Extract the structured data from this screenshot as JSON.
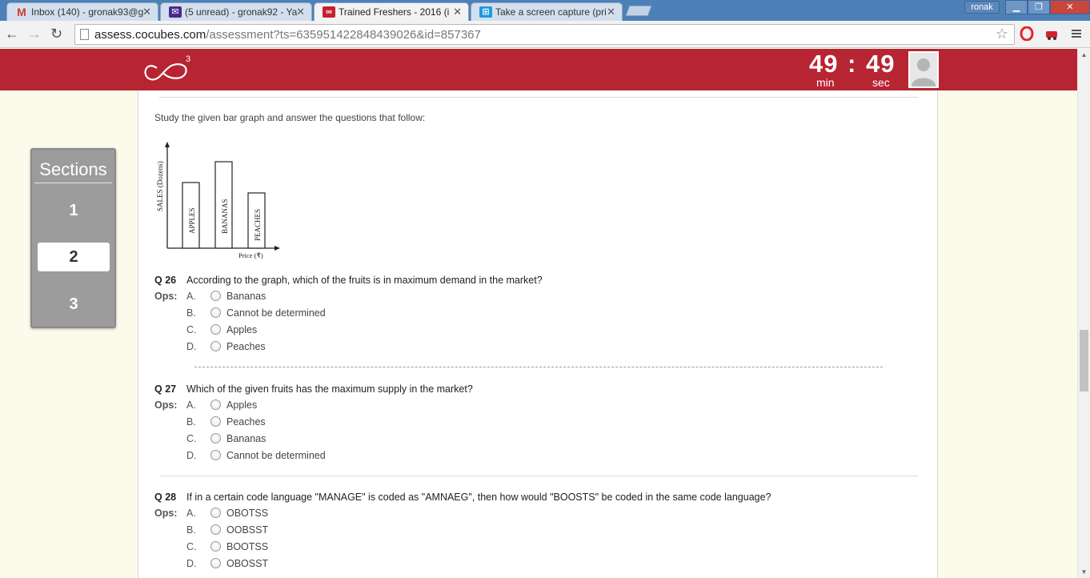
{
  "browser": {
    "tabs": [
      {
        "title": "Inbox (140) - gronak93@g",
        "icon": "gmail-icon",
        "active": false
      },
      {
        "title": "(5 unread) - gronak92 - Ya",
        "icon": "yahoo-mail-icon",
        "active": false
      },
      {
        "title": "Trained Freshers - 2016 (i",
        "icon": "cocubes-icon",
        "active": true
      },
      {
        "title": "Take a screen capture (pri",
        "icon": "windows-icon",
        "active": false
      }
    ],
    "profile_name": "ronak",
    "url_host": "assess.cocubes.com",
    "url_path": "/assessment?ts=635951422848439026&id=857367"
  },
  "header": {
    "logo_superscript": "3",
    "timer": {
      "minutes": "49",
      "separator": ":",
      "seconds": "49",
      "min_label": "min",
      "sec_label": "sec"
    }
  },
  "sections": {
    "title": "Sections",
    "items": [
      "1",
      "2",
      "3"
    ],
    "active": "2"
  },
  "content": {
    "intro": "Study the given bar graph and answer the questions that follow:",
    "graph": {
      "ylabel": "SALES (Dozens)",
      "xlabel": "Price (₹)",
      "bars": [
        "APPLES",
        "BANANAS",
        "PEACHES"
      ]
    },
    "questions": [
      {
        "number": "Q 26",
        "text": "According to the graph, which of the fruits is in maximum demand in the market?",
        "ops_label": "Ops:",
        "options": [
          {
            "letter": "A.",
            "text": "Bananas"
          },
          {
            "letter": "B.",
            "text": "Cannot be determined"
          },
          {
            "letter": "C.",
            "text": "Apples"
          },
          {
            "letter": "D.",
            "text": "Peaches"
          }
        ]
      },
      {
        "number": "Q 27",
        "text": "Which of the given fruits has the maximum supply in the market?",
        "ops_label": "Ops:",
        "options": [
          {
            "letter": "A.",
            "text": "Apples"
          },
          {
            "letter": "B.",
            "text": "Peaches"
          },
          {
            "letter": "C.",
            "text": "Bananas"
          },
          {
            "letter": "D.",
            "text": "Cannot be determined"
          }
        ]
      },
      {
        "number": "Q 28",
        "text": "If in a certain code language \"MANAGE\" is coded as \"AMNAEG\", then how would \"BOOSTS\" be coded in the same code language?",
        "ops_label": "Ops:",
        "options": [
          {
            "letter": "A.",
            "text": "OBOTSS"
          },
          {
            "letter": "B.",
            "text": "OOBSST"
          },
          {
            "letter": "C.",
            "text": "BOOTSS"
          },
          {
            "letter": "D.",
            "text": "OBOSST"
          }
        ]
      }
    ]
  },
  "colors": {
    "header_red": "#b72432",
    "page_bg": "#fbfaeb",
    "tab_strip": "#4d80b7"
  }
}
